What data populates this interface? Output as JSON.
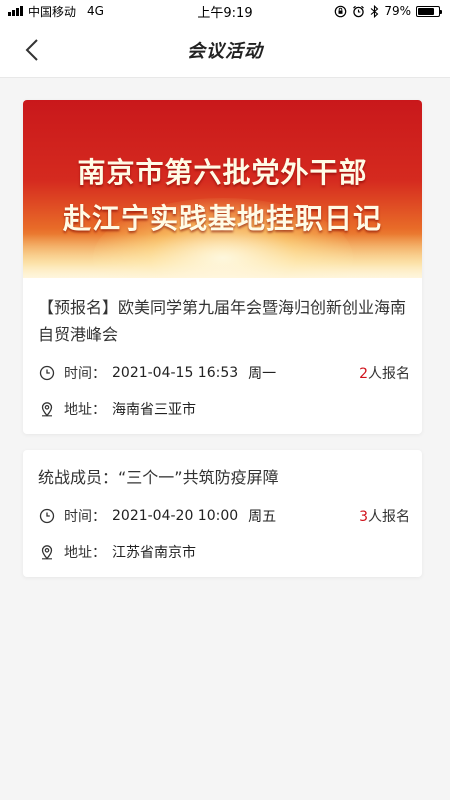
{
  "status_bar": {
    "carrier": "中国移动",
    "network": "4G",
    "time": "上午9:19",
    "battery_percent": "79%",
    "battery_level": 0.79
  },
  "nav": {
    "title": "会议活动",
    "back_icon": "chevron-left-icon"
  },
  "events": [
    {
      "banner_lines": [
        "南京市第六批党外干部",
        "赴江宁实践基地挂职日记"
      ],
      "title": "【预报名】欧美同学第九届年会暨海归创新创业海南自贸港峰会",
      "time_label": "时间：",
      "time_value": "2021-04-15 16:53",
      "weekday": "周一",
      "signup_count": "2",
      "signup_suffix": "人报名",
      "address_label": "地址：",
      "address_value": "海南省三亚市"
    },
    {
      "title": "统战成员：“三个一”共筑防疫屏障",
      "time_label": "时间：",
      "time_value": "2021-04-20 10:00",
      "weekday": "周五",
      "signup_count": "3",
      "signup_suffix": "人报名",
      "address_label": "地址：",
      "address_value": "江苏省南京市"
    }
  ],
  "colors": {
    "accent_red": "#d0121b",
    "page_bg": "#f5f5f5"
  }
}
